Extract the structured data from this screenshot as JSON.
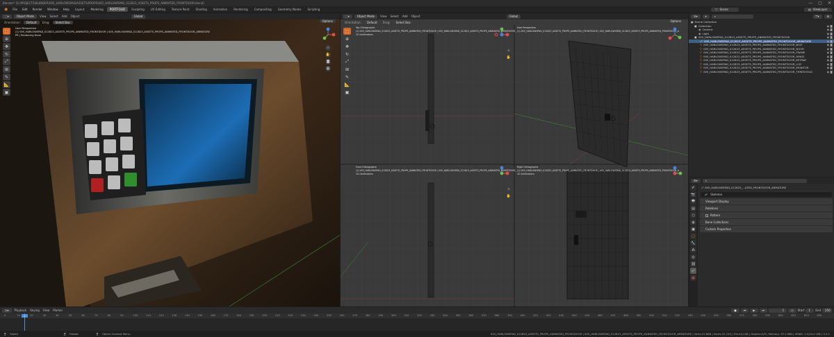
{
  "window": {
    "title": "Blender* [E:\\PROJECTS\\BLENDER\\005_HARLOWSPAD\\ASSETS\\PROPS\\005_HARLOWSPAD_012823_ASSETS_PROPS_ANIMATED_FRONTDOOR.blend]",
    "controls": [
      "—",
      "▢",
      "✕"
    ]
  },
  "menu": {
    "items": [
      "File",
      "Edit",
      "Render",
      "Window",
      "Help"
    ],
    "workspaces": [
      "Layout",
      "Modeling",
      "PORTFOLIO",
      "Sculpting",
      "UV Editing",
      "Texture Paint",
      "Shading",
      "Animation",
      "Rendering",
      "Compositing",
      "Geometry Nodes",
      "Scripting"
    ],
    "active_workspace": "PORTFOLIO",
    "scene_label": "Scene",
    "viewlayer_label": "ViewLayer"
  },
  "left_viewport": {
    "mode": "Object Mode",
    "menus": [
      "View",
      "Select",
      "Add",
      "Object"
    ],
    "transform": "Global",
    "orientation_label": "Orientation:",
    "orientation_value": "Default",
    "drag_label": "Drag:",
    "drag_value": "Select Box",
    "options": "Options",
    "info_lines": [
      "User Perspective",
      "(1) 005_HARLOWSPAD_012823_ASSETS_PROPS_ANIMATED_FRONTDOOR | 005_HARLOWSPAD_012823_ASSETS_PROPS_ANIMATED_FRONTDOOR_ARMATURE",
      "PR | Rendering Done"
    ]
  },
  "mid_viewport": {
    "mode": "Object Mode",
    "menus": [
      "View",
      "Select",
      "Add",
      "Object"
    ],
    "transform": "Global",
    "orientation_label": "Orientation:",
    "orientation_value": "Default",
    "drag_label": "Drag:",
    "drag_value": "Select Box",
    "options": "Options",
    "top_left": [
      "Top Orthographic",
      "(1) 005_HARLOWSPAD_012823_ASSETS_PROPS_ANIMATED_FRONTDOOR | 005_HARLOWSPAD_012823_ASSETS_PROPS_ANIMATED_FRONTDOOR_",
      "10 Centimeters"
    ],
    "top_right": [
      "User Perspective",
      "(1) 005_HARLOWSPAD_012823_ASSETS_PROPS_ANIMATED_FRONTDOOR | 005_HARLOWSPAD_012823_ASSETS_PROPS_ANIMATED_FRONTDOOR_A"
    ],
    "bottom_left": [
      "Front Orthographic",
      "(1) 005_HARLOWSPAD_012823_ASSETS_PROPS_ANIMATED_FRONTDOOR | 005_HARLOWSPAD_012823_ASSETS_PROPS_ANIMATED_FRONTDOOR_",
      "10 Centimeters"
    ],
    "bottom_right": [
      "Right Orthographic",
      "(1) 005_HARLOWSPAD_012823_ASSETS_PROPS_ANIMATED_FRONTDOOR | 005_HARLOWSPAD_012823_ASSETS_PROPS_ANIMATED_FRONTDOOR_A",
      "10 Centimeters"
    ]
  },
  "outliner": {
    "header": "Scene Collection",
    "rows": [
      {
        "label": "Collection",
        "type": "collection",
        "selected": false
      },
      {
        "label": "Camera",
        "type": "object",
        "selected": false
      },
      {
        "label": "Light",
        "type": "object",
        "selected": false
      },
      {
        "label": "005_HARLOWSPAD_012823_ASSETS_PROPS_ANIMATED_FRONTDOOR",
        "type": "collection",
        "selected": false
      },
      {
        "label": "005_HARLOWSPAD_012823_ASSETS_PROPS_ANIMATED_FRONTDOOR_ARMATURE",
        "type": "armature",
        "selected": true
      },
      {
        "label": "005_HARLOWSPAD_012823_ASSETS_PROPS_ANIMATED_FRONTDOOR_BOLT",
        "type": "mesh",
        "selected": false
      },
      {
        "label": "005_HARLOWSPAD_012823_ASSETS_PROPS_ANIMATED_FRONTDOOR_DOOR",
        "type": "mesh",
        "selected": false
      },
      {
        "label": "005_HARLOWSPAD_012823_ASSETS_PROPS_ANIMATED_FRONTDOOR_FRAME",
        "type": "mesh",
        "selected": false
      },
      {
        "label": "005_HARLOWSPAD_012823_ASSETS_PROPS_ANIMATED_FRONTDOOR_HINGE",
        "type": "mesh",
        "selected": false
      },
      {
        "label": "005_HARLOWSPAD_012823_ASSETS_PROPS_ANIMATED_FRONTDOOR_KEYPAD",
        "type": "mesh",
        "selected": false
      },
      {
        "label": "005_HARLOWSPAD_012823_ASSETS_PROPS_ANIMATED_FRONTDOOR_LCD",
        "type": "mesh",
        "selected": false
      },
      {
        "label": "005_HARLOWSPAD_012823_ASSETS_PROPS_ANIMATED_FRONTDOOR_MONITOR",
        "type": "mesh",
        "selected": false
      },
      {
        "label": "005_HARLOWSPAD_012823_ASSETS_PROPS_ANIMATED_FRONTDOOR_THRESHOLD",
        "type": "mesh",
        "selected": false
      }
    ]
  },
  "properties": {
    "breadcrumb": "005_HARLOWSPAD_012823_...ATED_FRONTDOOR_ARMATURE",
    "object_name": "Skeleton",
    "panels": [
      "Viewport Display",
      "Relations",
      "Pose",
      "Bone Collections",
      "Custom Properties"
    ],
    "hidden_panel_label": "Pattern",
    "hidden_panel_checked": false
  },
  "timeline": {
    "menus": [
      "Playback",
      "Keying",
      "View",
      "Marker"
    ],
    "current_frame": "1",
    "start_label": "Start",
    "start": "1",
    "end_label": "End",
    "end": "250",
    "ticks": [
      "0",
      "10",
      "20",
      "30",
      "40",
      "50",
      "60",
      "70",
      "80",
      "90",
      "100",
      "110",
      "120",
      "130",
      "140",
      "150",
      "160",
      "170",
      "180",
      "190",
      "200",
      "210",
      "220",
      "230",
      "240",
      "250",
      "260",
      "270",
      "280",
      "290",
      "300",
      "310",
      "320",
      "330",
      "340",
      "350",
      "360",
      "370",
      "380",
      "390",
      "400",
      "410",
      "420",
      "430",
      "440",
      "450",
      "460",
      "470",
      "480",
      "490",
      "500",
      "510",
      "520",
      "530",
      "540",
      "550",
      "560",
      "570",
      "580",
      "590",
      "600",
      "610",
      "620",
      "630"
    ]
  },
  "status": {
    "select": "Select",
    "rotate": "Rotate",
    "context": "Object Context Menu",
    "info": "005_HARLOWSPAD_012823_ASSETS_PROPS_ANIMATED_FRONTDOOR | 005_HARLOWSPAD_012823_ASSETS_PROPS_ANIMATED_FRONTDOOR_ARMATURE | Verts:22,668 | Faces:22,124 | Tris:44,248 | Objects:0/9 | Memory: 97.2 MiB | VRAM: 1.0/24.0 GiB | 3.4.1"
  },
  "colors": {
    "accent": "#d36a2a",
    "selection": "#3e5f86",
    "axis_x": "#e44b4b",
    "axis_y": "#6bc04b",
    "axis_z": "#4a83e4"
  }
}
